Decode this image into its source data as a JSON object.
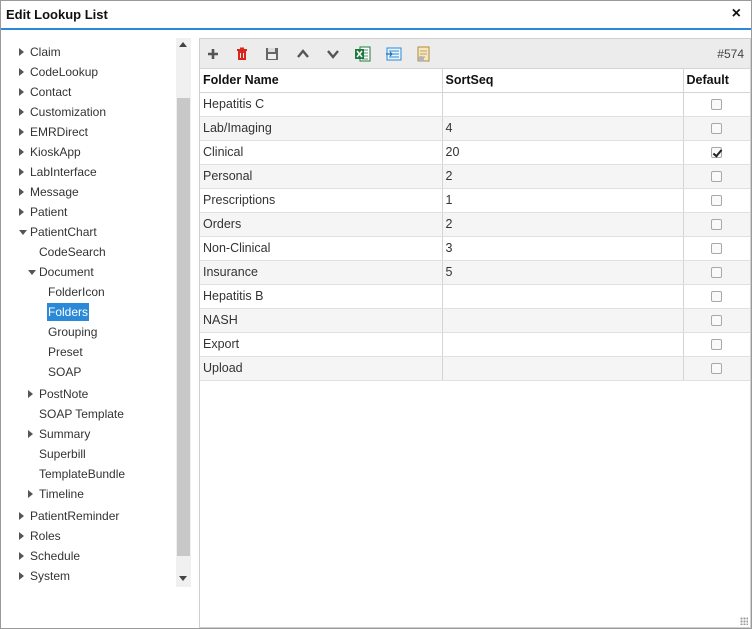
{
  "window": {
    "title": "Edit Lookup List",
    "close_label": "×"
  },
  "tree": [
    {
      "label": "Claim",
      "level": 0,
      "state": "collapsed"
    },
    {
      "label": "CodeLookup",
      "level": 0,
      "state": "collapsed"
    },
    {
      "label": "Contact",
      "level": 0,
      "state": "collapsed"
    },
    {
      "label": "Customization",
      "level": 0,
      "state": "collapsed"
    },
    {
      "label": "EMRDirect",
      "level": 0,
      "state": "collapsed"
    },
    {
      "label": "KioskApp",
      "level": 0,
      "state": "collapsed"
    },
    {
      "label": "LabInterface",
      "level": 0,
      "state": "collapsed"
    },
    {
      "label": "Message",
      "level": 0,
      "state": "collapsed"
    },
    {
      "label": "Patient",
      "level": 0,
      "state": "collapsed"
    },
    {
      "label": "PatientChart",
      "level": 0,
      "state": "expanded"
    },
    {
      "label": "CodeSearch",
      "level": 1,
      "state": "leaf"
    },
    {
      "label": "Document",
      "level": 1,
      "state": "expanded"
    },
    {
      "label": "FolderIcon",
      "level": 2,
      "state": "leaf"
    },
    {
      "label": "Folders",
      "level": 2,
      "state": "leaf",
      "selected": true
    },
    {
      "label": "Grouping",
      "level": 2,
      "state": "leaf"
    },
    {
      "label": "Preset",
      "level": 2,
      "state": "leaf"
    },
    {
      "label": "SOAP",
      "level": 2,
      "state": "leaf"
    },
    {
      "label": "PostNote",
      "level": 1,
      "state": "collapsed"
    },
    {
      "label": "SOAP Template",
      "level": 1,
      "state": "leaf"
    },
    {
      "label": "Summary",
      "level": 1,
      "state": "collapsed"
    },
    {
      "label": "Superbill",
      "level": 1,
      "state": "leaf"
    },
    {
      "label": "TemplateBundle",
      "level": 1,
      "state": "leaf"
    },
    {
      "label": "Timeline",
      "level": 1,
      "state": "collapsed"
    },
    {
      "label": "PatientReminder",
      "level": 0,
      "state": "collapsed"
    },
    {
      "label": "Roles",
      "level": 0,
      "state": "collapsed"
    },
    {
      "label": "Schedule",
      "level": 0,
      "state": "collapsed"
    },
    {
      "label": "System",
      "level": 0,
      "state": "collapsed"
    }
  ],
  "toolbar": {
    "record_count": "#574",
    "icons": [
      "add-icon",
      "delete-icon",
      "save-icon",
      "move-up-icon",
      "move-down-icon",
      "export-excel-icon",
      "export-csv-icon",
      "import-file-icon"
    ]
  },
  "grid": {
    "columns": [
      "Folder Name",
      "SortSeq",
      "Default"
    ],
    "rows": [
      {
        "name": "Hepatitis C",
        "sortseq": "",
        "default": false
      },
      {
        "name": "Lab/Imaging",
        "sortseq": "4",
        "default": false
      },
      {
        "name": "Clinical",
        "sortseq": "20",
        "default": true
      },
      {
        "name": "Personal",
        "sortseq": "2",
        "default": false
      },
      {
        "name": "Prescriptions",
        "sortseq": "1",
        "default": false
      },
      {
        "name": "Orders",
        "sortseq": "2",
        "default": false
      },
      {
        "name": "Non-Clinical",
        "sortseq": "3",
        "default": false
      },
      {
        "name": "Insurance",
        "sortseq": "5",
        "default": false
      },
      {
        "name": "Hepatitis B",
        "sortseq": "",
        "default": false
      },
      {
        "name": "NASH",
        "sortseq": "",
        "default": false
      },
      {
        "name": "Export",
        "sortseq": "",
        "default": false
      },
      {
        "name": "Upload",
        "sortseq": "",
        "default": false
      }
    ]
  },
  "colors": {
    "accent": "#2b8ad8",
    "delete": "#d9261c",
    "excel": "#1e7a3c"
  }
}
